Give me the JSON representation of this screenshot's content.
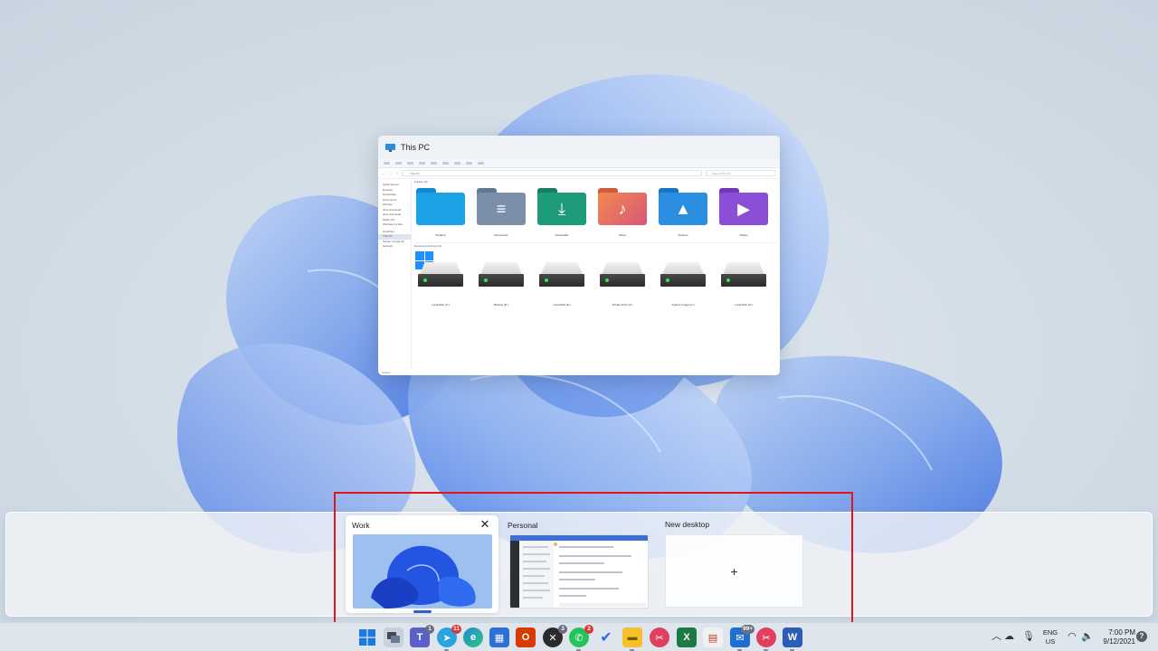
{
  "explorer": {
    "title": "This PC",
    "address": "This PC",
    "search_placeholder": "Search This PC",
    "nav_items": [
      "Quick access",
      "Desktop",
      "Downloads",
      "Documents",
      "Pictures",
      "drive download",
      "drive download",
      "HKEC list",
      "Windows 11 files",
      "OneDrive",
      "This PC",
      "System Image (K)",
      "Network"
    ],
    "folders_header": "Folders (6)",
    "folders": [
      {
        "label": "Desktop",
        "icon": "desktop-folder-icon",
        "color": "#1aa1e6"
      },
      {
        "label": "Documents",
        "icon": "documents-folder-icon",
        "color": "#7b8fa8"
      },
      {
        "label": "Downloads",
        "icon": "downloads-folder-icon",
        "color": "#1e9b78"
      },
      {
        "label": "Music",
        "icon": "music-folder-icon",
        "color": "#e8704a"
      },
      {
        "label": "Pictures",
        "icon": "pictures-folder-icon",
        "color": "#2a8fe0"
      },
      {
        "label": "Videos",
        "icon": "videos-folder-icon",
        "color": "#8a4fd6"
      }
    ],
    "drives_header": "Devices and drives (6)",
    "drives": [
      "Local Disk (C:)",
      "Backup (D:)",
      "Local Disk (E:)",
      "Private Drive (F:)",
      "System Image (G:)",
      "Local Disk (H:)"
    ],
    "status": "6 items"
  },
  "desktops": [
    {
      "label": "Work",
      "active": true
    },
    {
      "label": "Personal",
      "active": false
    }
  ],
  "new_desktop": {
    "label": "New desktop",
    "plus": "+"
  },
  "taskbar": {
    "apps": [
      {
        "name": "start",
        "icon": "windows-start-icon",
        "color": "#1a7ae0"
      },
      {
        "name": "task-view",
        "icon": "task-view-icon",
        "color": "#3d4a5e"
      },
      {
        "name": "teams",
        "icon": "teams-chat-icon",
        "color": "#5b5fc7",
        "badge": "1"
      },
      {
        "name": "telegram",
        "icon": "telegram-icon",
        "color": "#2aa3e0",
        "badge": "11"
      },
      {
        "name": "edge",
        "icon": "edge-icon",
        "color": "#1c8bd6"
      },
      {
        "name": "store",
        "icon": "store-icon",
        "color": "#2c6fd6"
      },
      {
        "name": "office",
        "icon": "office-icon",
        "color": "#d83b01"
      },
      {
        "name": "xbox",
        "icon": "xbox-icon",
        "color": "#2b2b2b",
        "badge": "3"
      },
      {
        "name": "whatsapp",
        "icon": "whatsapp-icon",
        "color": "#25c45a",
        "badge": "2"
      },
      {
        "name": "todo",
        "icon": "todo-icon",
        "color": "#2f6fe0"
      },
      {
        "name": "file-explorer",
        "icon": "file-explorer-icon",
        "color": "#f5c02a"
      },
      {
        "name": "app-red",
        "icon": "snip-icon",
        "color": "#e04060"
      },
      {
        "name": "excel",
        "icon": "excel-icon",
        "color": "#1d7a45"
      },
      {
        "name": "app-doc",
        "icon": "document-app-icon",
        "color": "#c0392b"
      },
      {
        "name": "mail",
        "icon": "mail-icon",
        "color": "#1f6fd0",
        "badge": "99+"
      },
      {
        "name": "app-red2",
        "icon": "snip-icon",
        "color": "#e04060"
      },
      {
        "name": "word",
        "icon": "word-icon",
        "color": "#2b5cb8"
      }
    ],
    "badge_labels": {
      "teams": "1",
      "telegram": "11",
      "xbox": "3",
      "whatsapp": "2",
      "mail": "99+"
    },
    "tray": {
      "lang_line1": "ENG",
      "lang_line2": "US",
      "time": "7:00 PM",
      "date": "9/12/2021",
      "help": "?"
    }
  },
  "accent_color": "#e0151d"
}
